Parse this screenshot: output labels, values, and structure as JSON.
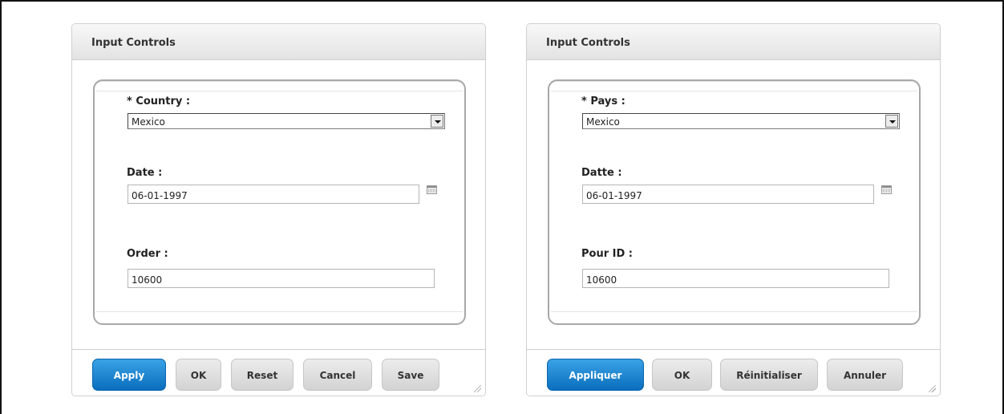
{
  "panels": [
    {
      "title": "Input Controls",
      "country_label": "* Country :",
      "country_value": "Mexico",
      "date_label": "Date :",
      "date_value": "06-01-1997",
      "order_label": "Order :",
      "order_value": "10600",
      "buttons": {
        "apply": "Apply",
        "ok": "OK",
        "reset": "Reset",
        "cancel": "Cancel",
        "save": "Save"
      }
    },
    {
      "title": "Input Controls",
      "country_label": "* Pays :",
      "country_value": "Mexico",
      "date_label": "Datte :",
      "date_value": "06-01-1997",
      "order_label": "Pour ID :",
      "order_value": "10600",
      "buttons": {
        "apply": "Appliquer",
        "ok": "OK",
        "reset": "Réinitialiser",
        "cancel": "Annuler"
      }
    }
  ],
  "icons": {
    "calendar": "calendar-icon",
    "dropdown": "chevron-down-icon",
    "resize": "resize-grip-icon"
  },
  "colors": {
    "primary_button": "#1a84d1",
    "secondary_button": "#dcdcdc"
  }
}
